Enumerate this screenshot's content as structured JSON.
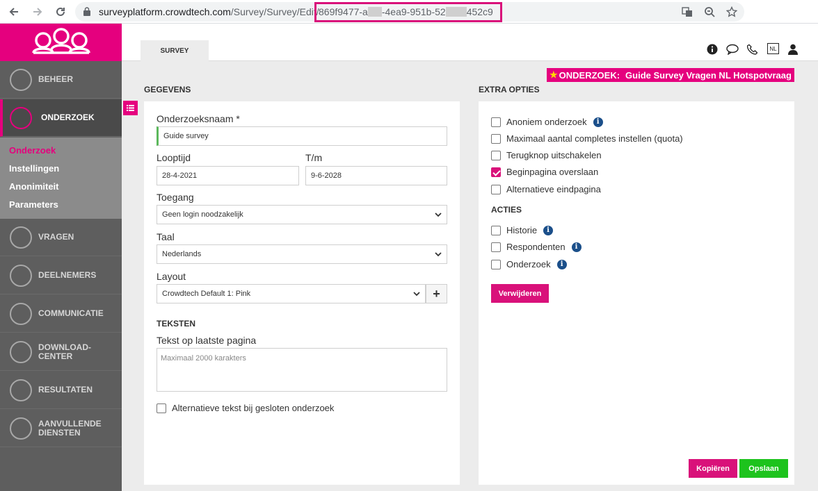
{
  "browser": {
    "url_host": "surveyplatform.crowdtech.com",
    "url_path": "/Survey/Survey/Edit/",
    "url_id_part1": "869f9477-a",
    "url_id_part2": "-4ea9-951b-52",
    "url_id_part3": "452c9"
  },
  "sidebar": {
    "items": [
      {
        "label": "BEHEER",
        "icon": "home-icon"
      },
      {
        "label": "ONDERZOEK",
        "icon": "clipboard-icon"
      },
      {
        "label": "VRAGEN",
        "icon": "checklist-icon"
      },
      {
        "label": "DEELNEMERS",
        "icon": "users-icon"
      },
      {
        "label": "COMMUNICATIE",
        "icon": "chat-icon"
      },
      {
        "label": "DOWNLOAD-",
        "label2": "CENTER",
        "icon": "download-icon"
      },
      {
        "label": "RESULTATEN",
        "icon": "pie-chart-icon"
      },
      {
        "label": "AANVULLENDE",
        "label2": "DIENSTEN",
        "icon": "info-icon"
      }
    ],
    "submenu": [
      "Onderzoek",
      "Instellingen",
      "Anonimiteit",
      "Parameters"
    ]
  },
  "topbar": {
    "tab": "SURVEY",
    "lang": "NL"
  },
  "badge": {
    "key": "ONDERZOEK:",
    "value": "Guide Survey Vragen NL Hotspotvraag"
  },
  "gegevens": {
    "title": "GEGEVENS",
    "name_label": "Onderzoeksnaam *",
    "name_value": "Guide survey",
    "looptijd_label": "Looptijd",
    "looptijd_value": "28-4-2021",
    "tm_label": "T/m",
    "tm_value": "9-6-2028",
    "toegang_label": "Toegang",
    "toegang_value": "Geen login noodzakelijk",
    "taal_label": "Taal",
    "taal_value": "Nederlands",
    "layout_label": "Layout",
    "layout_value": "Crowdtech Default 1: Pink",
    "teksten_title": "TEKSTEN",
    "tekst_label": "Tekst op laatste pagina",
    "tekst_placeholder": "Maximaal 2000 karakters",
    "alt_text_label": "Alternatieve tekst bij gesloten onderzoek"
  },
  "extra": {
    "title": "EXTRA OPTIES",
    "options": [
      {
        "label": "Anoniem onderzoek",
        "checked": false,
        "info": true
      },
      {
        "label": "Maximaal aantal completes instellen (quota)",
        "checked": false,
        "info": false
      },
      {
        "label": "Terugknop uitschakelen",
        "checked": false,
        "info": false
      },
      {
        "label": "Beginpagina overslaan",
        "checked": true,
        "info": false
      },
      {
        "label": "Alternatieve eindpagina",
        "checked": false,
        "info": false
      }
    ],
    "acties_title": "ACTIES",
    "acties": [
      {
        "label": "Historie",
        "checked": false
      },
      {
        "label": "Respondenten",
        "checked": false
      },
      {
        "label": "Onderzoek",
        "checked": false
      }
    ],
    "delete_label": "Verwijderen"
  },
  "footer": {
    "copy_label": "Kopiëren",
    "save_label": "Opslaan"
  }
}
